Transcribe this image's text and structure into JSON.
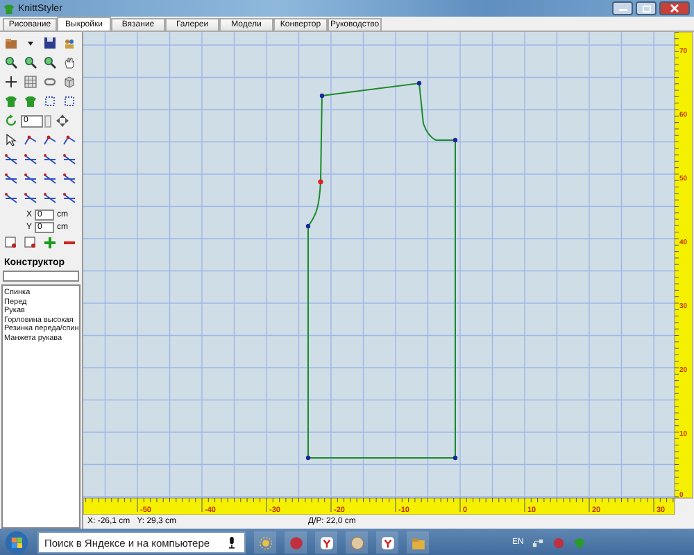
{
  "window": {
    "title": "KnittStyler"
  },
  "tabs": [
    {
      "label": "Рисование",
      "selected": false
    },
    {
      "label": "Выкройки",
      "selected": true
    },
    {
      "label": "Вязание",
      "selected": false
    },
    {
      "label": "Галереи",
      "selected": false
    },
    {
      "label": "Модели",
      "selected": false
    },
    {
      "label": "Конвертор",
      "selected": false
    },
    {
      "label": "Руководство",
      "selected": false
    }
  ],
  "toolbar": {
    "spinner_value": "0"
  },
  "offset": [
    {
      "label": "X",
      "value": "0",
      "unit": "cm"
    },
    {
      "label": "Y",
      "value": "0",
      "unit": "cm"
    }
  ],
  "constructor": {
    "title": "Конструктор",
    "items": [
      "Спинка",
      "Перед",
      "Рукав",
      "Горловина высокая",
      "Резинка переда/спин",
      "Манжета рукава"
    ]
  },
  "rulers": {
    "horizontal": [
      "-50",
      "-40",
      "-30",
      "-20",
      "-10",
      "0",
      "10",
      "20",
      "30"
    ],
    "vertical": [
      "70",
      "60",
      "50",
      "40",
      "30",
      "20",
      "10",
      "0"
    ]
  },
  "status_bar": {
    "cursor_x": "X: -26,1 cm",
    "cursor_y": "Y: 29,3 cm",
    "measure": "Д/Р: 22,0 cm"
  },
  "taskbar": {
    "search": {
      "placeholder": "Поиск в Яндексе и на компьютере"
    },
    "language": "EN"
  }
}
